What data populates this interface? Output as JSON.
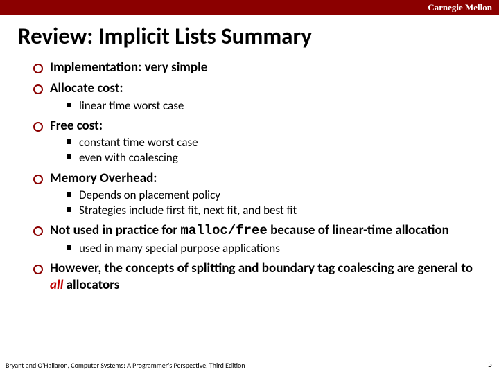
{
  "header": {
    "institution": "Carnegie Mellon"
  },
  "title": "Review: Implicit Lists Summary",
  "bullets": [
    {
      "head": "Implementation: very simple",
      "subs": []
    },
    {
      "head": "Allocate cost:",
      "subs": [
        "linear time worst case"
      ]
    },
    {
      "head": "Free cost:",
      "subs": [
        "constant time worst case",
        "even with coalescing"
      ]
    },
    {
      "head": "Memory Overhead:",
      "subs": [
        "Depends on placement policy",
        "Strategies include first fit, next fit, and best fit"
      ]
    },
    {
      "head_pre": "Not used in practice for ",
      "mono": "malloc/free",
      "head_post": "  because of linear-time allocation",
      "subs": [
        "used in many special purpose applications"
      ]
    },
    {
      "head_pre": "However, the concepts of splitting and boundary tag coalescing are general to ",
      "emph": "all",
      "head_post": " allocators",
      "subs": []
    }
  ],
  "footer": {
    "citation": "Bryant and O'Hallaron, Computer Systems: A Programmer's Perspective, Third Edition",
    "page": "5"
  }
}
